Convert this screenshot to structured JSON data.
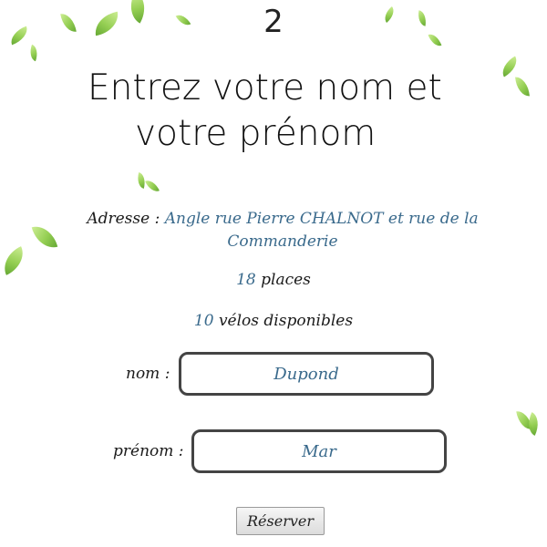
{
  "step": {
    "number": "2"
  },
  "title": {
    "line1": "Entrez votre nom et",
    "line2": "votre prénom"
  },
  "station": {
    "address_label": "Adresse :",
    "address_value": "Angle rue Pierre CHALNOT et rue de la Commanderie",
    "places_count": "18",
    "places_label": "places",
    "bikes_count": "10",
    "bikes_label": "vélos disponibles"
  },
  "form": {
    "nom_label": "nom :",
    "nom_value": "Dupond",
    "prenom_label": "prénom :",
    "prenom_value": "Mar",
    "submit_label": "Réserver"
  },
  "colors": {
    "accent": "#3a6a8c",
    "leaf": "#8fcc4a"
  }
}
